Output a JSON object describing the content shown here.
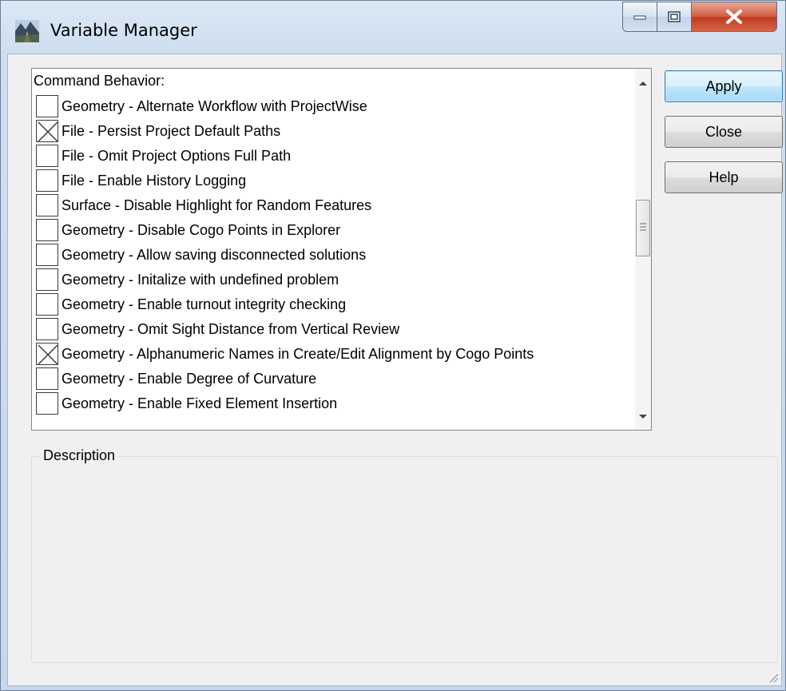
{
  "window": {
    "title": "Variable Manager",
    "icons": {
      "app": "variable-manager-app-icon",
      "minimize": "minimize-icon",
      "maximize": "maximize-icon",
      "close": "close-icon"
    }
  },
  "list": {
    "header": "Command Behavior:",
    "items": [
      {
        "label": "Geometry - Alternate Workflow with ProjectWise",
        "checked": false
      },
      {
        "label": "File - Persist Project Default Paths",
        "checked": true
      },
      {
        "label": "File - Omit Project Options Full Path",
        "checked": false
      },
      {
        "label": "File - Enable History Logging",
        "checked": false
      },
      {
        "label": "Surface - Disable Highlight for Random Features",
        "checked": false
      },
      {
        "label": "Geometry - Disable Cogo Points in Explorer",
        "checked": false
      },
      {
        "label": "Geometry - Allow saving disconnected solutions",
        "checked": false
      },
      {
        "label": "Geometry - Initalize with undefined problem",
        "checked": false
      },
      {
        "label": "Geometry - Enable turnout integrity checking",
        "checked": false
      },
      {
        "label": "Geometry - Omit Sight Distance from Vertical Review",
        "checked": false
      },
      {
        "label": "Geometry - Alphanumeric Names in Create/Edit Alignment by Cogo Points",
        "checked": true
      },
      {
        "label": "Geometry - Enable Degree of Curvature",
        "checked": false
      },
      {
        "label": "Geometry - Enable Fixed Element Insertion",
        "checked": false
      }
    ]
  },
  "buttons": {
    "apply": "Apply",
    "close": "Close",
    "help": "Help"
  },
  "description": {
    "label": "Description",
    "text": ""
  },
  "colors": {
    "default_button_border": "#3c7fb1",
    "close_button": "#c7452a",
    "dialog_background": "#f0f0f0"
  }
}
